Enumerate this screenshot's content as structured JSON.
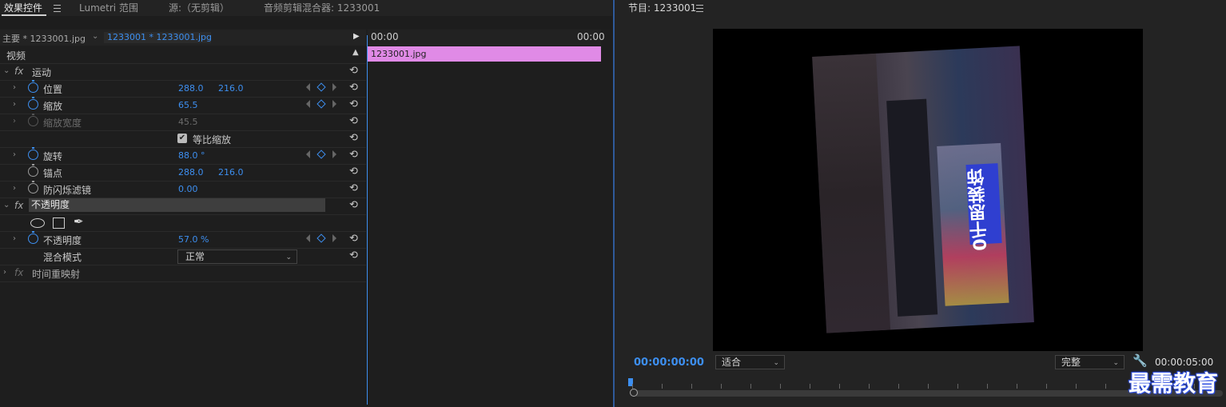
{
  "tabs": [
    {
      "label": "效果控件"
    },
    {
      "label": "Lumetri 范围"
    },
    {
      "label": "源:（无剪辑）"
    },
    {
      "label": "音频剪辑混合器: 1233001"
    }
  ],
  "effect_controls": {
    "master_clip": "主要 * 1233001.jpg",
    "sequence_clip": "1233001 * 1233001.jpg",
    "time_start": "00:00",
    "time_end": "00:00",
    "clip_name": "1233001.jpg",
    "section_video": "视频",
    "motion": {
      "name": "运动",
      "position": {
        "label": "位置",
        "x": "288.0",
        "y": "216.0"
      },
      "scale": {
        "label": "缩放",
        "value": "65.5"
      },
      "scale_width": {
        "label": "缩放宽度",
        "value": "45.5"
      },
      "uniform_scale": {
        "label": "等比缩放",
        "checked": true
      },
      "rotation": {
        "label": "旋转",
        "value": "88.0 °"
      },
      "anchor": {
        "label": "锚点",
        "x": "288.0",
        "y": "216.0"
      },
      "anti_flicker": {
        "label": "防闪烁滤镜",
        "value": "0.00"
      }
    },
    "opacity": {
      "name": "不透明度",
      "opacity": {
        "label": "不透明度",
        "value": "57.0 %"
      },
      "blend": {
        "label": "混合模式",
        "value": "正常"
      }
    },
    "time_remap": {
      "name": "时间重映射"
    }
  },
  "program": {
    "title": "节目: 1233001",
    "timecode_current": "00:00:00:00",
    "zoom": "适合",
    "resolution": "完整",
    "timecode_end": "00:00:05:00",
    "image_sign_text": "0千思装饰"
  },
  "watermark": "最需教育",
  "colors": {
    "accent": "#3d8ff0",
    "clip": "#e08ae6"
  }
}
